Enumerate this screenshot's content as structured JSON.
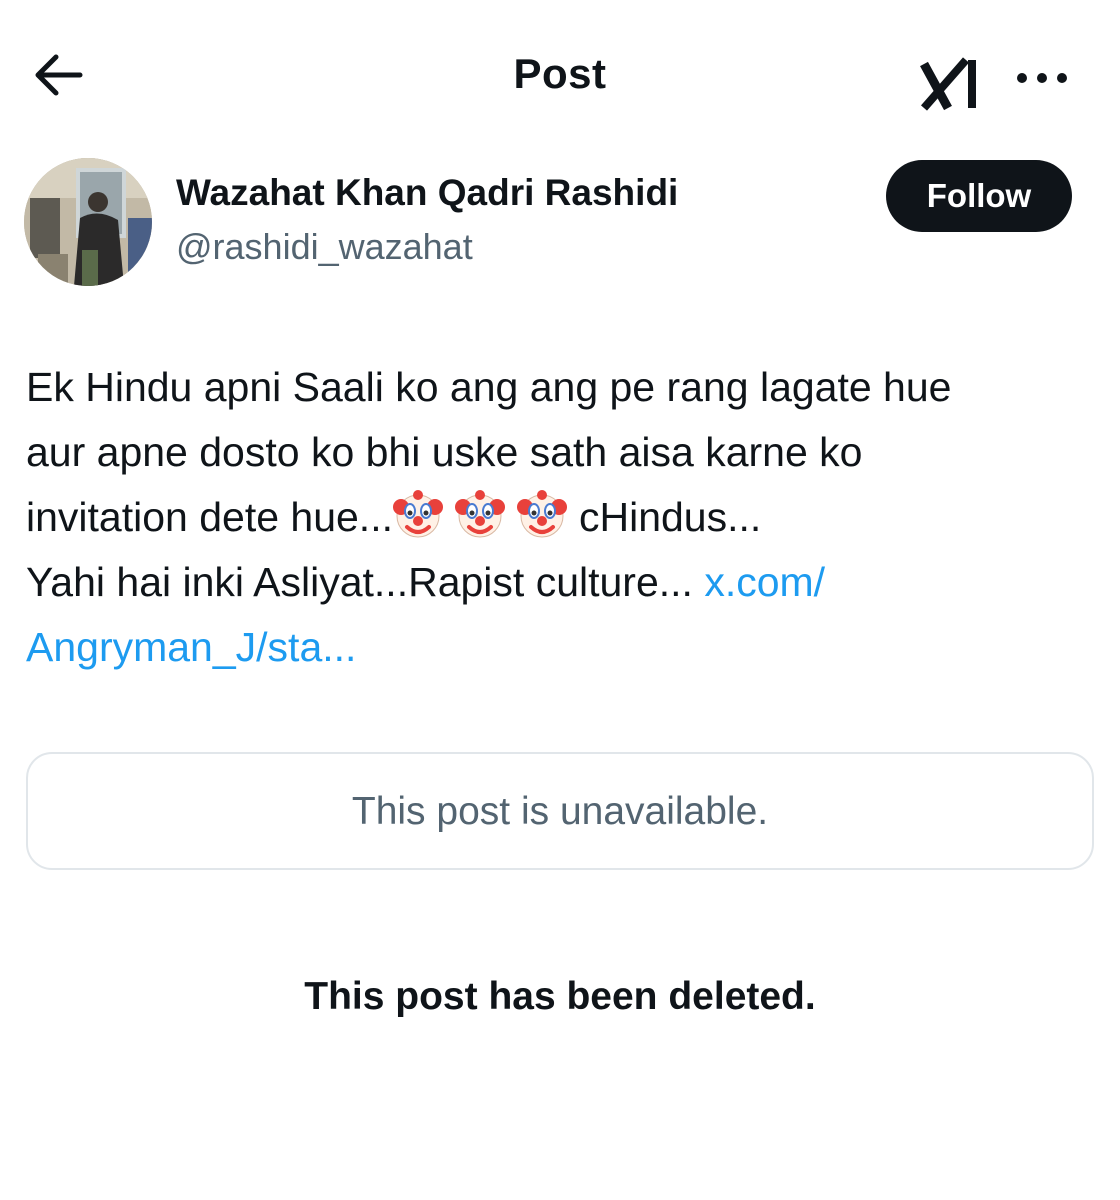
{
  "header": {
    "title": "Post",
    "back_icon": "arrow-left-icon",
    "grok_icon": "grok-logo-icon",
    "more_icon": "more-dots-icon"
  },
  "author": {
    "name": "Wazahat Khan Qadri Rashidi",
    "handle": "@rashidi_wazahat",
    "follow_label": "Follow"
  },
  "post": {
    "line1": "Ek Hindu apni Saali ko ang ang pe rang lagate hue",
    "line2": "aur apne dosto ko bhi uske sath aisa karne ko",
    "line3_text": "invitation dete hue...",
    "emoji_icon": "clown-face-emoji",
    "line3_after": "cHindus...",
    "line4_text": "Yahi hai inki Asliyat...Rapist culture... ",
    "link_part1": "x.com/",
    "link_part2": "Angryman_J/sta..."
  },
  "quoted_post": {
    "text": "This post is unavailable."
  },
  "status": {
    "deleted_text": "This post has been deleted."
  },
  "colors": {
    "text": "#0f1419",
    "secondary_text": "#536471",
    "link": "#1d9bf0",
    "follow_bg": "#0f1419",
    "card_border": "#e1e6ea"
  }
}
